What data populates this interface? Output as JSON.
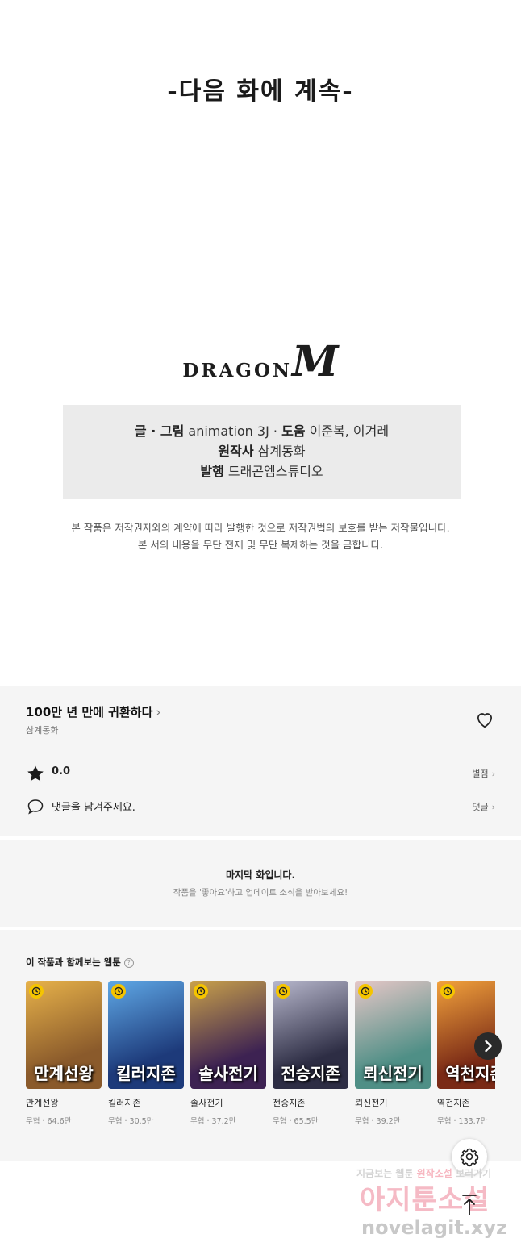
{
  "episode_end": {
    "next_title": "-다음 화에 계속-",
    "logo": {
      "word": "DRAGON",
      "mark": "M"
    },
    "credits": {
      "line1": {
        "writer_label": "글 · 그림",
        "writer": " animation 3J · ",
        "assist_label": "도움",
        "assist": " 이준복, 이겨레"
      },
      "line2": {
        "label": "원작사",
        "value": " 삼계동화"
      },
      "line3": {
        "label": "발행",
        "value": " 드래곤엠스튜디오"
      }
    },
    "copyright": {
      "line1": "본 작품은 저작권자와의 계약에 따라 발행한 것으로 저작권법의 보호를 받는 저작물입니다.",
      "line2": "본 서의 내용을 무단 전재 및 무단 복제하는 것을 금합니다."
    }
  },
  "work": {
    "title": "100만 년 만에 귀환하다",
    "chevron": "›",
    "author": "삼계동화",
    "rating": {
      "value": "0.0",
      "link": "별점"
    },
    "comment": {
      "prompt": "댓글을 남겨주세요.",
      "link": "댓글"
    }
  },
  "last_episode": {
    "title": "마지막 화입니다.",
    "subtitle": "작품을 '좋아요'하고 업데이트 소식을 받아보세요!"
  },
  "recommendations": {
    "heading": "이 작품과 함께보는 웹툰",
    "help": "?",
    "items": [
      {
        "name": "만계선왕",
        "meta": "무협 · 64.6만",
        "art": "만계선왕",
        "bg": "#8a5a2b",
        "bg2": "#e7b24a"
      },
      {
        "name": "킬러지존",
        "meta": "무협 · 30.5만",
        "art": "킬러지존",
        "bg": "#1d3a7a",
        "bg2": "#5fa8e6"
      },
      {
        "name": "솔사전기",
        "meta": "무협 · 37.2만",
        "art": "솔사전기",
        "bg": "#3d2252",
        "bg2": "#c9a14a"
      },
      {
        "name": "전승지존",
        "meta": "무협 · 65.5만",
        "art": "전승지존",
        "bg": "#2d2d44",
        "bg2": "#b7b7cc"
      },
      {
        "name": "뢰신전기",
        "meta": "무협 · 39.2만",
        "art": "뢰신전기",
        "bg": "#4f8f86",
        "bg2": "#e6c7c7"
      },
      {
        "name": "역천지존",
        "meta": "무협 · 133.7만",
        "art": "역천지존",
        "bg": "#7a2a16",
        "bg2": "#f2a23c"
      }
    ]
  },
  "watermark": {
    "line1_a": "지금보는 웹툰 ",
    "line1_b": "원작소설",
    "line1_c": " 보러가기",
    "line2": "아지툰소설",
    "line3": "novelagit.xyz"
  },
  "colors": {
    "panel_bg": "#f5f5f5",
    "credit_bg": "#ebebeb",
    "badge": "#f5c400",
    "watermark_pink": "#f4b3bf"
  }
}
